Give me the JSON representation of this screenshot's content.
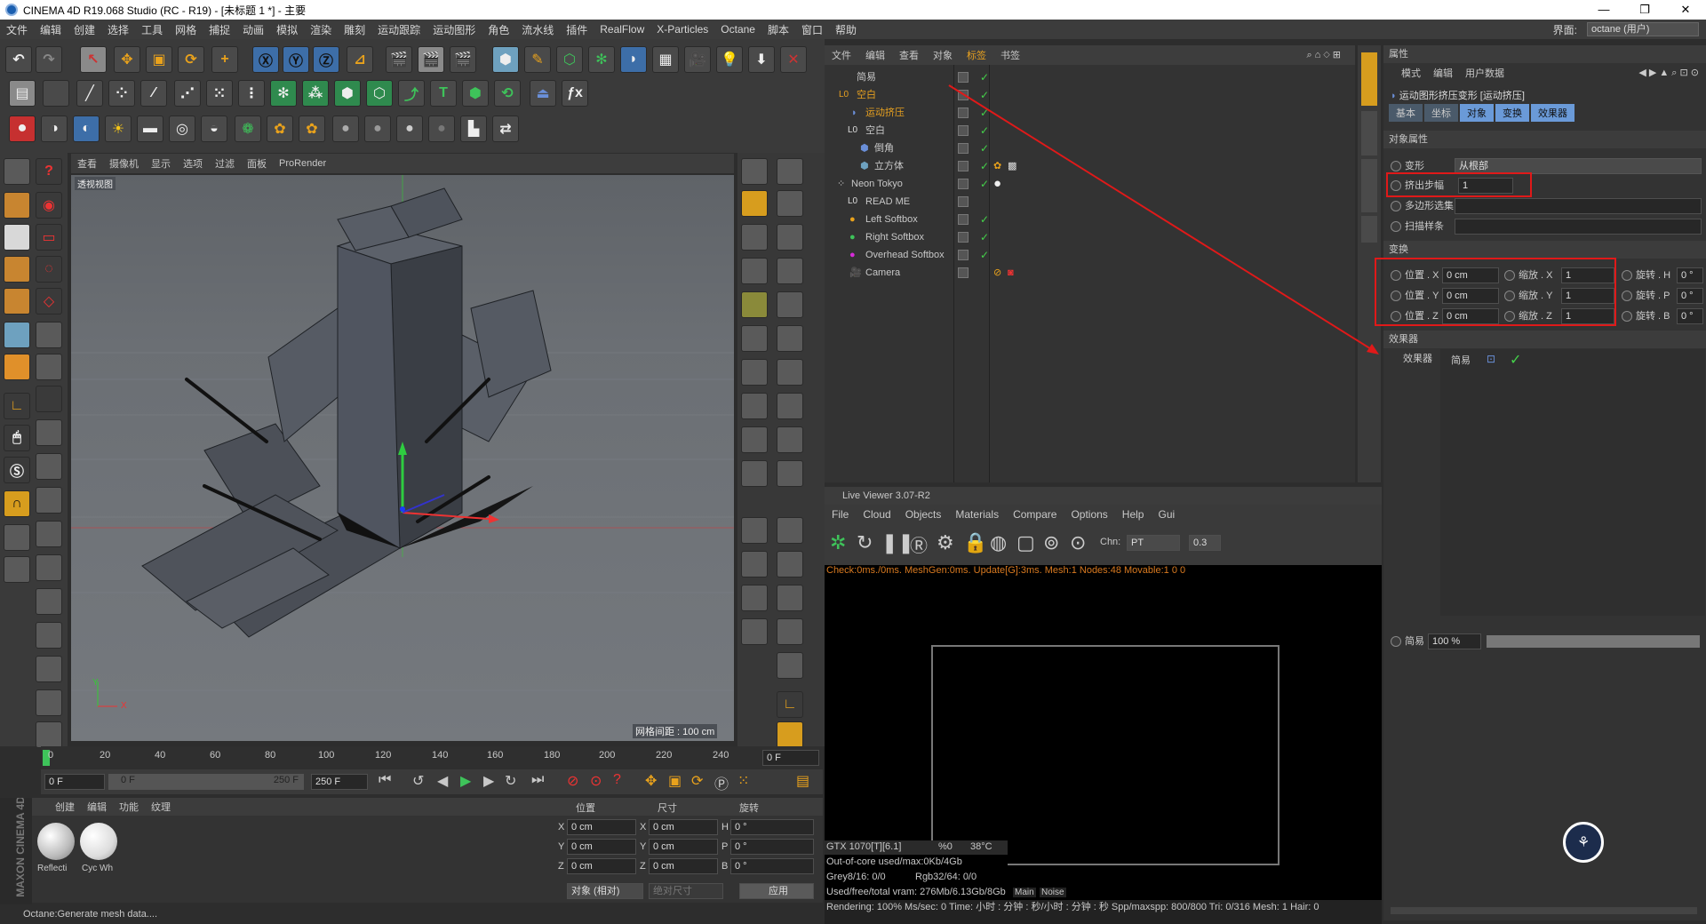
{
  "window": {
    "title": "CINEMA 4D R19.068 Studio (RC - R19) - [未标题 1 *] - 主要",
    "min": "—",
    "max": "❐",
    "close": "✕"
  },
  "menu": {
    "items": [
      "文件",
      "编辑",
      "创建",
      "选择",
      "工具",
      "网格",
      "捕捉",
      "动画",
      "模拟",
      "渲染",
      "雕刻",
      "运动跟踪",
      "运动图形",
      "角色",
      "流水线",
      "插件",
      "RealFlow",
      "X-Particles",
      "Octane",
      "脚本",
      "窗口",
      "帮助"
    ],
    "interface_label": "界面:",
    "interface_value": "octane (用户)"
  },
  "viewport": {
    "menu": [
      "查看",
      "摄像机",
      "显示",
      "选项",
      "过滤",
      "面板",
      "ProRender"
    ],
    "label": "透视视图",
    "grid_info": "网格间距 : 100 cm",
    "axis_y": "Y",
    "axis_x": "X"
  },
  "object_manager": {
    "menu": [
      "文件",
      "编辑",
      "查看",
      "对象",
      "标签",
      "书签"
    ],
    "objects": [
      {
        "name": "简易",
        "color": "#d8d8d8"
      },
      {
        "name": "空白",
        "color": "#e6a020"
      },
      {
        "name": "运动挤压",
        "color": "#e6a020"
      },
      {
        "name": "空白",
        "color": "#d8d8d8"
      },
      {
        "name": "倒角",
        "color": "#d8d8d8"
      },
      {
        "name": "立方体",
        "color": "#d8d8d8"
      },
      {
        "name": "Neon Tokyo",
        "color": "#d8d8d8"
      },
      {
        "name": "READ ME",
        "color": "#d8d8d8"
      },
      {
        "name": "Left Softbox",
        "color": "#d8d8d8"
      },
      {
        "name": "Right Softbox",
        "color": "#d8d8d8"
      },
      {
        "name": "Overhead Softbox",
        "color": "#d8d8d8"
      },
      {
        "name": "Camera",
        "color": "#d8d8d8"
      }
    ]
  },
  "attributes": {
    "panel_title": "属性",
    "menu": [
      "模式",
      "编辑",
      "用户数据"
    ],
    "object_title": "运动图形挤压变形 [运动挤压]",
    "tabs": [
      "基本",
      "坐标",
      "对象",
      "变换",
      "效果器"
    ],
    "section_object": "对象属性",
    "deform_label": "变形",
    "deform_value": "从根部",
    "steps_label": "挤出步幅",
    "steps_value": "1",
    "polyselect_label": "多边形选集",
    "sweep_label": "扫描样条",
    "section_transform": "变换",
    "pos": [
      {
        "label": "位置 . X",
        "value": "0 cm"
      },
      {
        "label": "位置 . Y",
        "value": "0 cm"
      },
      {
        "label": "位置 . Z",
        "value": "0 cm"
      }
    ],
    "scale": [
      {
        "label": "缩放 . X",
        "value": "1"
      },
      {
        "label": "缩放 . Y",
        "value": "1"
      },
      {
        "label": "缩放 . Z",
        "value": "1"
      }
    ],
    "rot": [
      {
        "label": "旋转 . H",
        "value": "0 °"
      },
      {
        "label": "旋转 . P",
        "value": "0 °"
      },
      {
        "label": "旋转 . B",
        "value": "0 °"
      }
    ],
    "section_effectors": "效果器",
    "effectors_label": "效果器",
    "effector_name": "简易",
    "strength_label": "简易",
    "strength_value": "100 %"
  },
  "live_viewer": {
    "title": "Live Viewer 3.07-R2",
    "menu": [
      "File",
      "Cloud",
      "Objects",
      "Materials",
      "Compare",
      "Options",
      "Help",
      "Gui"
    ],
    "chn_label": "Chn:",
    "chn_value": "PT",
    "chn_num": "0.3",
    "status_line": "Check:0ms./0ms. MeshGen:0ms. Update[G]:3ms. Mesh:1 Nodes:48 Movable:1  0 0",
    "gpu": "GTX 1070[T][6.1]",
    "gpu_pct": "%0",
    "gpu_temp": "38°C",
    "ooc": "Out-of-core used/max:0Kb/4Gb",
    "grey": "Grey8/16: 0/0",
    "rgb": "Rgb32/64: 0/0",
    "vram": "Used/free/total vram: 276Mb/6.13Gb/8Gb",
    "tab_main": "Main",
    "tab_noise": "Noise",
    "render_line": "Rendering: 100%   Ms/sec: 0   Time: 小时 : 分钟 : 秒/小时 : 分钟 : 秒   Spp/maxspp: 800/800    Tri: 0/316   Mesh: 1    Hair: 0"
  },
  "timeline": {
    "ticks": [
      "0",
      "20",
      "40",
      "60",
      "80",
      "100",
      "120",
      "140",
      "160",
      "180",
      "200",
      "220",
      "240"
    ],
    "end_frame": "0 F",
    "start": "0 F",
    "range_start": "0 F",
    "range_end": "250 F",
    "end": "250 F"
  },
  "materials": {
    "menu": [
      "创建",
      "编辑",
      "功能",
      "纹理"
    ],
    "items": [
      "Reflecti",
      "Cyc Wh"
    ],
    "brand": "MAXON CINEMA 4D"
  },
  "coords": {
    "headers": [
      "位置",
      "尺寸",
      "旋转"
    ],
    "rows": [
      {
        "a": "X",
        "av": "0 cm",
        "b": "X",
        "bv": "0 cm",
        "c": "H",
        "cv": "0 °"
      },
      {
        "a": "Y",
        "av": "0 cm",
        "b": "Y",
        "bv": "0 cm",
        "c": "P",
        "cv": "0 °"
      },
      {
        "a": "Z",
        "av": "0 cm",
        "b": "Z",
        "bv": "0 cm",
        "c": "B",
        "cv": "0 °"
      }
    ],
    "mode": "对象 (相对)",
    "size_mode": "绝对尺寸",
    "apply": "应用"
  },
  "status": "Octane:Generate mesh data...."
}
